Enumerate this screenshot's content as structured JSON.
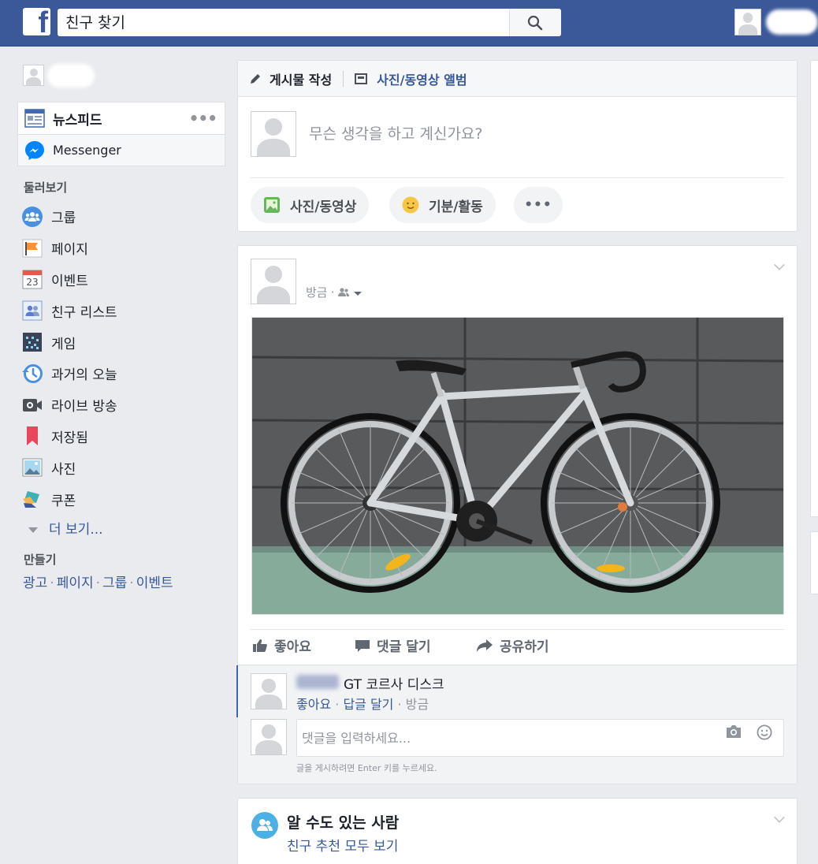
{
  "topbar": {
    "search_placeholder": "친구 찾기",
    "icons": [
      "facebook-logo",
      "search-icon"
    ]
  },
  "sidebar": {
    "nav": [
      {
        "label": "뉴스피드",
        "icon": "newsfeed-icon"
      },
      {
        "label": "Messenger",
        "icon": "messenger-icon"
      }
    ],
    "explore_title": "둘러보기",
    "explore_items": [
      {
        "label": "그룹",
        "icon": "groups-icon"
      },
      {
        "label": "페이지",
        "icon": "pages-flag-icon"
      },
      {
        "label": "이벤트",
        "icon": "events-calendar-icon"
      },
      {
        "label": "친구 리스트",
        "icon": "friend-lists-icon"
      },
      {
        "label": "게임",
        "icon": "games-icon"
      },
      {
        "label": "과거의 오늘",
        "icon": "on-this-day-icon"
      },
      {
        "label": "라이브 방송",
        "icon": "live-video-icon"
      },
      {
        "label": "저장됨",
        "icon": "saved-bookmark-icon"
      },
      {
        "label": "사진",
        "icon": "photos-icon"
      },
      {
        "label": "쿠폰",
        "icon": "offers-icon"
      }
    ],
    "more_label": "더 보기...",
    "create_title": "만들기",
    "create_links": [
      "광고",
      "페이지",
      "그룹",
      "이벤트"
    ],
    "calendar_day": "23"
  },
  "composer": {
    "tab_write": "게시물 작성",
    "tab_album": "사진/동영상 앨범",
    "placeholder": "무슨 생각을 하고 계신가요?",
    "btn_photo": "사진/동영상",
    "btn_feeling": "기분/활동",
    "btn_more": "•••"
  },
  "post": {
    "time": "방금",
    "privacy_icon": "friends-icon",
    "actions": {
      "like": "좋아요",
      "comment": "댓글 달기",
      "share": "공유하기"
    },
    "comment": {
      "text": "GT 코르사 디스크",
      "like": "좋아요",
      "reply": "답글 달기",
      "time": "방금"
    },
    "comment_placeholder": "댓글을 입력하세요...",
    "comment_hint": "글을 게시하려면 Enter 키를 누르세요."
  },
  "pymk": {
    "title": "알 수도 있는 사람",
    "link": "친구 추천 모두 보기"
  },
  "colors": {
    "brand": "#3b5998",
    "link": "#365899",
    "background": "#e9ebee"
  }
}
